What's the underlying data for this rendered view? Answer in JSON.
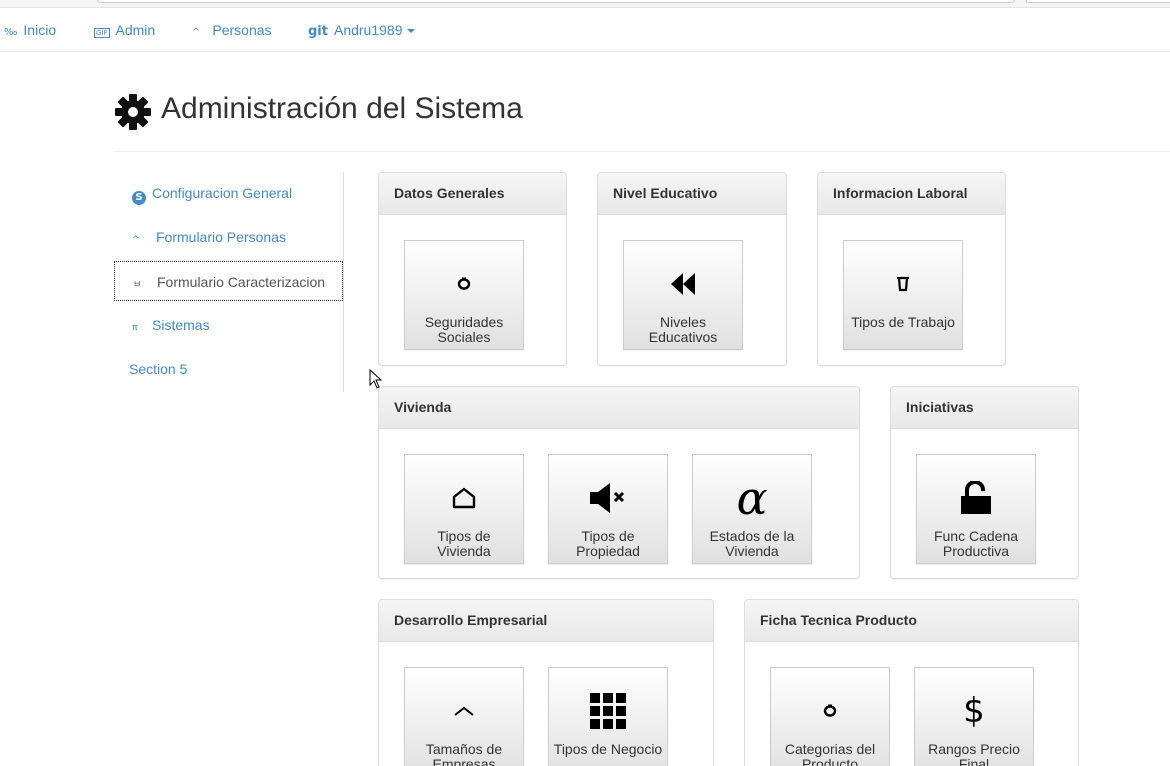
{
  "navbar": {
    "items": [
      {
        "icon": "per-mille-icon",
        "glyph": "‰",
        "label": "Inicio"
      },
      {
        "icon": "gif-icon",
        "glyph": "GIF",
        "label": "Admin"
      },
      {
        "icon": "caret-up-icon",
        "glyph": "^",
        "label": "Personas"
      },
      {
        "icon": "git-icon",
        "glyph": "git",
        "label": "Andru1989"
      }
    ]
  },
  "header": {
    "title": "Administración del Sistema",
    "icon": "gear-icon"
  },
  "sidebar": {
    "items": [
      {
        "label": "Configuracion General",
        "icon": "skype-icon",
        "glyph": "S"
      },
      {
        "label": "Formulario Personas",
        "icon": "caret-up-icon",
        "glyph": "^"
      },
      {
        "label": "Formulario Caracterizacion",
        "icon": "bracket-icon",
        "glyph": "ㅂ"
      },
      {
        "label": "Sistemas",
        "icon": "pi-icon",
        "glyph": "π"
      },
      {
        "label": "Section 5",
        "icon": "",
        "glyph": ""
      }
    ]
  },
  "panels": {
    "datos": {
      "title": "Datos Generales",
      "tiles": [
        {
          "icon": "ring-icon",
          "label": "Seguridades Sociales"
        }
      ]
    },
    "nivel": {
      "title": "Nivel Educativo",
      "tiles": [
        {
          "icon": "fast-backward-icon",
          "label": "Niveles Educativos"
        }
      ]
    },
    "laboral": {
      "title": "Informacion Laboral",
      "tiles": [
        {
          "icon": "bucket-icon",
          "label": "Tipos de Trabajo"
        }
      ]
    },
    "vivienda": {
      "title": "Vivienda",
      "tiles": [
        {
          "icon": "house-icon",
          "label": "Tipos de Vivienda"
        },
        {
          "icon": "volume-mute-icon",
          "label": "Tipos de Propiedad"
        },
        {
          "icon": "alpha-icon",
          "label": "Estados de la Vivienda"
        }
      ]
    },
    "iniciativas": {
      "title": "Iniciativas",
      "tiles": [
        {
          "icon": "unlock-icon",
          "label": "Func Cadena Productiva"
        }
      ]
    },
    "desarrollo": {
      "title": "Desarrollo Empresarial",
      "tiles": [
        {
          "icon": "chevron-up-icon",
          "label": "Tamaños de Empresas"
        },
        {
          "icon": "grid-icon",
          "label": "Tipos de Negocio"
        }
      ]
    },
    "ficha": {
      "title": "Ficha Tecnica Producto",
      "tiles": [
        {
          "icon": "ring-icon",
          "label": "Categorias del Producto"
        },
        {
          "icon": "dollar-icon",
          "label": "Rangos Precio Final"
        }
      ]
    }
  },
  "colors": {
    "link": "#428bca",
    "text": "#333333"
  }
}
